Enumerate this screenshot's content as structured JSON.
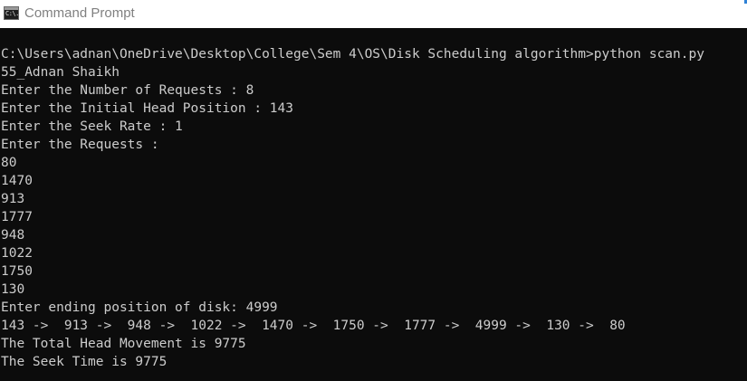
{
  "window": {
    "title": "Command Prompt",
    "icon": "cmd-icon",
    "icon_glyph": "C:\\.",
    "accent_color": "#2f82d6"
  },
  "console": {
    "lines": [
      "C:\\Users\\adnan\\OneDrive\\Desktop\\College\\Sem 4\\OS\\Disk Scheduling algorithm>python scan.py",
      "55_Adnan Shaikh",
      "Enter the Number of Requests : 8",
      "Enter the Initial Head Position : 143",
      "Enter the Seek Rate : 1",
      "Enter the Requests :",
      "80",
      "1470",
      "913",
      "1777",
      "948",
      "1022",
      "1750",
      "130",
      "Enter ending position of disk: 4999",
      "143 ->  913 ->  948 ->  1022 ->  1470 ->  1750 ->  1777 ->  4999 ->  130 ->  80",
      "The Total Head Movement is 9775",
      "The Seek Time is 9775"
    ]
  }
}
